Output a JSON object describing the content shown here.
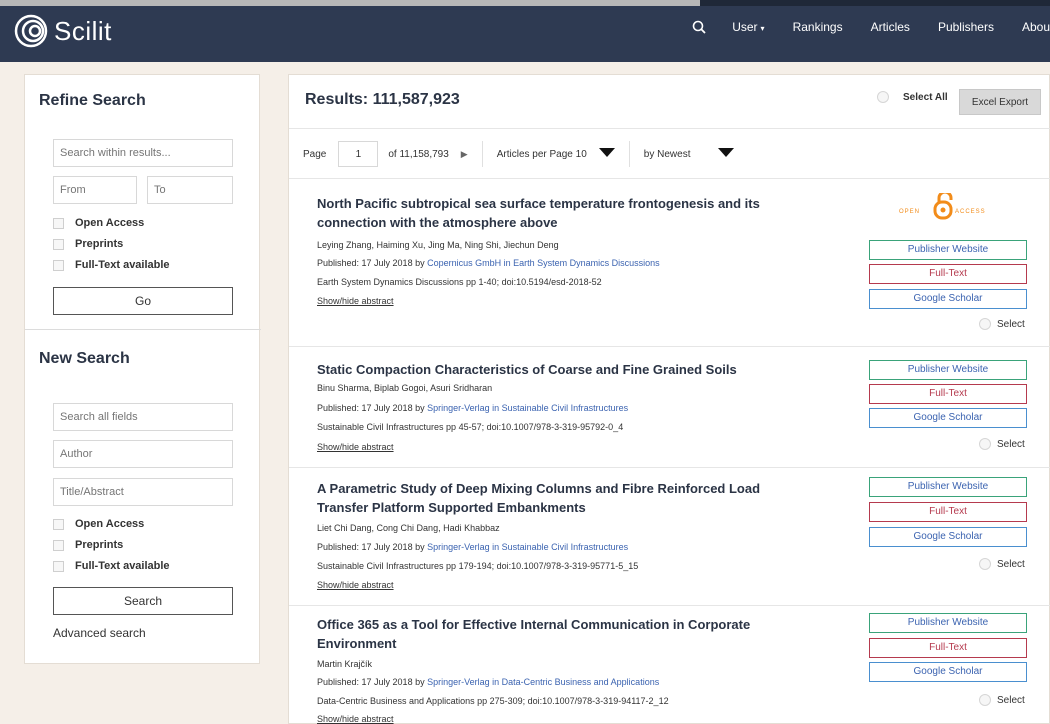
{
  "header": {
    "app_name": "Scilit",
    "nav": {
      "search_icon": "search-icon",
      "user": "User",
      "rankings": "Rankings",
      "articles": "Articles",
      "publishers": "Publishers",
      "about": "Abou"
    }
  },
  "sidebar": {
    "refine_heading": "Refine Search",
    "search_within_placeholder": "Search within results...",
    "from_placeholder": "From",
    "to_placeholder": "To",
    "filters": [
      "Open Access",
      "Preprints",
      "Full-Text available"
    ],
    "go_label": "Go",
    "new_heading": "New Search",
    "all_fields_placeholder": "Search all fields",
    "author_placeholder": "Author",
    "title_placeholder": "Title/Abstract",
    "filters2": [
      "Open Access",
      "Preprints",
      "Full-Text available"
    ],
    "search_label": "Search",
    "advanced_label": "Advanced search"
  },
  "results_header": {
    "title": "Results: 111,587,923",
    "select_all": "Select All",
    "excel_export": "Excel Export",
    "page_label": "Page",
    "page_value": "1",
    "of_pages": "of 11,158,793",
    "next_arrow": "▶",
    "per_page": "Articles per Page 10",
    "sort": "by Newest"
  },
  "result_buttons": {
    "publisher": "Publisher Website",
    "fulltext": "Full-Text",
    "scholar": "Google Scholar",
    "select": "Select",
    "toggle": "Show/hide abstract"
  },
  "open_access_logo": {
    "left": "OPEN",
    "right": "ACCESS",
    "color": "#f28c1a"
  },
  "results": [
    {
      "title": "North Pacific subtropical sea surface temperature frontogenesis and its connection with the atmosphere above",
      "authors": "Leying Zhang, Haiming Xu, Jing Ma, Ning Shi, Jiechun Deng",
      "published": "Published: 17 July 2018 by ",
      "publisher_link": "Copernicus GmbH in Earth System Dynamics Discussions",
      "citation": "Earth System Dynamics Discussions pp 1-40; doi:10.5194/esd-2018-52"
    },
    {
      "title": "Static Compaction Characteristics of Coarse and Fine Grained Soils",
      "authors": "Binu Sharma, Biplab Gogoi, Asuri Sridharan",
      "published": "Published: 17 July 2018 by ",
      "publisher_link": "Springer-Verlag in Sustainable Civil Infrastructures",
      "citation": "Sustainable Civil Infrastructures pp 45-57; doi:10.1007/978-3-319-95792-0_4"
    },
    {
      "title": "A Parametric Study of Deep Mixing Columns and Fibre Reinforced Load Transfer Platform Supported Embankments",
      "authors": "Liet Chi Dang, Cong Chi Dang, Hadi Khabbaz",
      "published": "Published: 17 July 2018 by ",
      "publisher_link": "Springer-Verlag in Sustainable Civil Infrastructures",
      "citation": "Sustainable Civil Infrastructures pp 179-194; doi:10.1007/978-3-319-95771-5_15"
    },
    {
      "title": "Office 365 as a Tool for Effective Internal Communication in Corporate Environment",
      "authors": "Martin Krajčík",
      "published": "Published: 17 July 2018 by ",
      "publisher_link": "Springer-Verlag in Data-Centric Business and Applications",
      "citation": "Data-Centric Business and Applications pp 275-309; doi:10.1007/978-3-319-94117-2_12"
    }
  ]
}
